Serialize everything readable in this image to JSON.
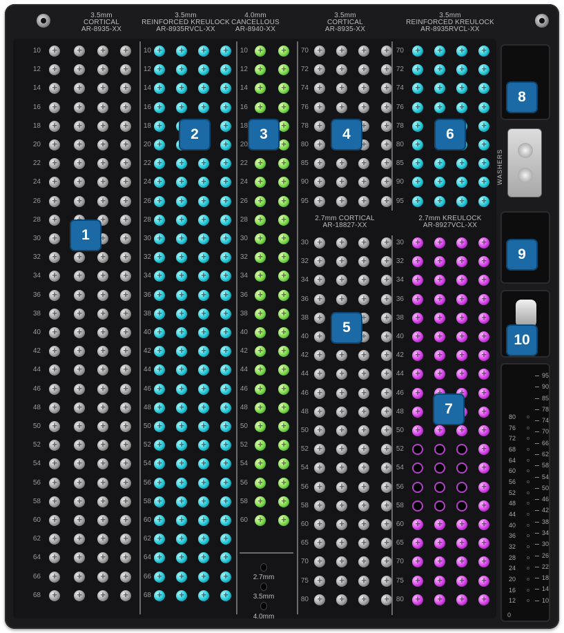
{
  "headers": [
    {
      "line1": "3.5mm",
      "line2": "CORTICAL",
      "line3": "AR-8935-XX"
    },
    {
      "line1": "3.5mm",
      "line2": "REINFORCED KREULOCK",
      "line3": "AR-8935RVCL-XX"
    },
    {
      "line1": "4.0mm",
      "line2": "CANCELLOUS",
      "line3": "AR-8940-XX"
    },
    {
      "line1": "3.5mm",
      "line2": "CORTICAL",
      "line3": "AR-8935-XX"
    },
    {
      "line1": "3.5mm",
      "line2": "REINFORCED KREULOCK",
      "line3": "AR-8935RVCL-XX"
    }
  ],
  "lower_headers": [
    {
      "line1": "2.7mm CORTICAL",
      "line2": "AR-18827-XX"
    },
    {
      "line1": "2.7mm KREULOCK",
      "line2": "AR-8927VCL-XX"
    }
  ],
  "left_rows": [
    "10",
    "12",
    "14",
    "16",
    "18",
    "20",
    "22",
    "24",
    "26",
    "28",
    "30",
    "32",
    "34",
    "36",
    "38",
    "40",
    "42",
    "44",
    "46",
    "48",
    "50",
    "52",
    "54",
    "56",
    "58",
    "60",
    "62",
    "64",
    "66",
    "68"
  ],
  "col3_rows": [
    "10",
    "12",
    "14",
    "16",
    "18",
    "20",
    "22",
    "24",
    "26",
    "28",
    "30",
    "32",
    "34",
    "36",
    "38",
    "40",
    "42",
    "44",
    "46",
    "48",
    "50",
    "52",
    "54",
    "56",
    "58",
    "60"
  ],
  "right_top_rows": [
    "70",
    "72",
    "74",
    "76",
    "78",
    "80",
    "85",
    "90",
    "95"
  ],
  "right_bottom_rows": [
    "30",
    "32",
    "34",
    "36",
    "38",
    "40",
    "42",
    "44",
    "46",
    "48",
    "50",
    "52",
    "54",
    "56",
    "58",
    "60",
    "65",
    "70",
    "75",
    "80"
  ],
  "badges": [
    "1",
    "2",
    "3",
    "4",
    "5",
    "6",
    "7",
    "8",
    "9",
    "10"
  ],
  "gauge_labels": [
    "2.7mm",
    "3.5mm",
    "4.0mm"
  ],
  "washers_label": "WASHERS",
  "ruler": {
    "right": [
      "95",
      "90",
      "85",
      "78",
      "74",
      "70",
      "66",
      "62",
      "58",
      "54",
      "50",
      "46",
      "42",
      "38",
      "34",
      "30",
      "26",
      "22",
      "18",
      "14",
      "10"
    ],
    "left": [
      "80",
      "76",
      "72",
      "68",
      "64",
      "60",
      "56",
      "52",
      "48",
      "44",
      "40",
      "36",
      "32",
      "28",
      "24",
      "20",
      "16",
      "12"
    ],
    "bottom": "0"
  },
  "colors": {
    "cortical": "#9d9d9d",
    "reinforced_kreulock": "#22c6d6",
    "cancellous": "#79d94a",
    "kreulock_27": "#d43ee8",
    "badge": "#1c6aa5"
  }
}
